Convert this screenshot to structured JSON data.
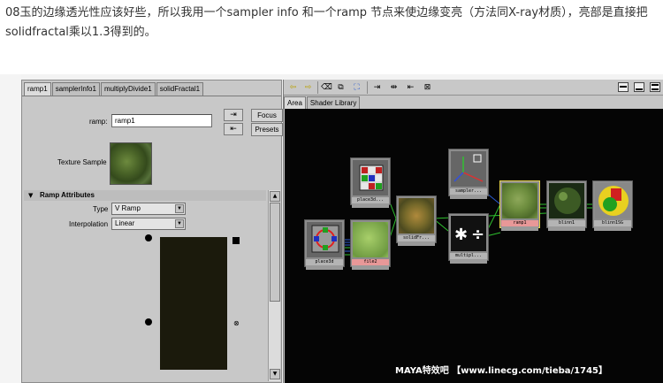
{
  "caption": "08玉的边缘透光性应该好些，所以我用一个sampler info 和一个ramp 节点来使边缘变亮（方法同X-ray材质），亮部是直接把solidfractal乘以1.3得到的。",
  "attribute_editor": {
    "tabs": [
      "ramp1",
      "samplerInfo1",
      "multiplyDivide1",
      "solidFractal1"
    ],
    "active_tab": "ramp1",
    "name_label": "ramp:",
    "name_value": "ramp1",
    "focus_button": "Focus",
    "presets_button": "Presets",
    "texture_sample_label": "Texture Sample",
    "section_title": "Ramp Attributes",
    "type_label": "Type",
    "type_value": "V Ramp",
    "interpolation_label": "Interpolation",
    "interpolation_value": "Linear"
  },
  "hypershade": {
    "tabs": [
      "Area",
      "Shader Library"
    ],
    "active_tab": "Area",
    "nodes": {
      "place3d_top": "place3d...",
      "place3d_left": "place3d",
      "file": "file2",
      "solidfractal": "solidFr...",
      "sampler": "sampler...",
      "multiply": "multipl...",
      "ramp": "ramp1",
      "blinn": "blinn1",
      "blinnsg": "blinn1SG"
    }
  },
  "watermark": "MAYA特效吧 【www.linecg.com/tieba/1745】",
  "colors": {
    "workarea": "#050505",
    "selected_border": "#e8d54a",
    "link_green": "#2ec02e",
    "link_blue": "#2a5ad0"
  }
}
